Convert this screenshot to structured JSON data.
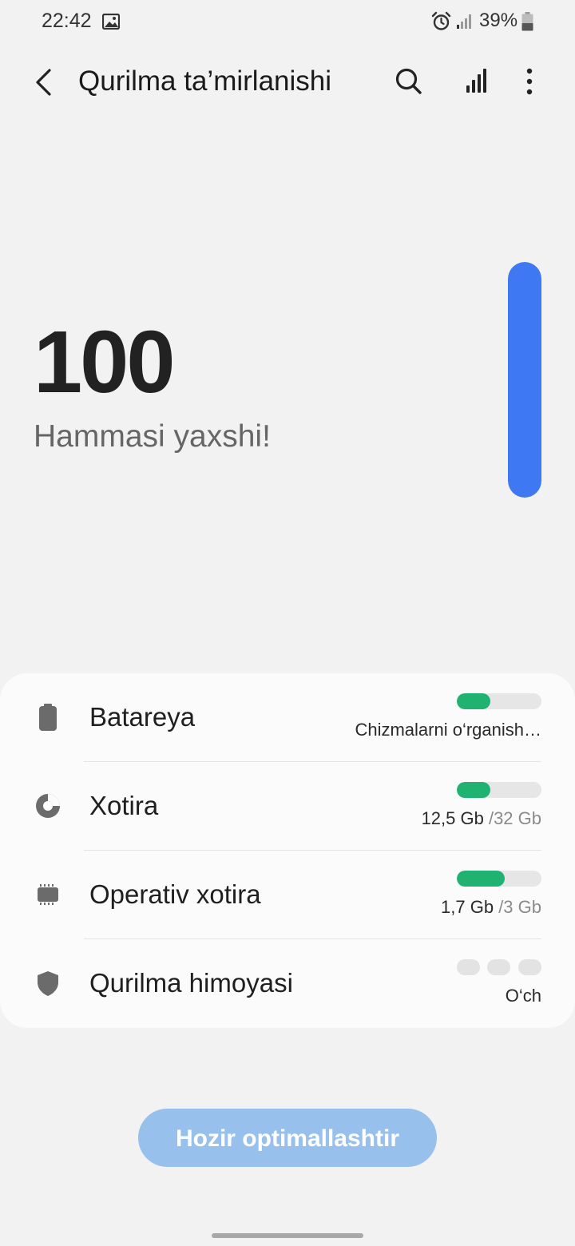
{
  "status_bar": {
    "time": "22:42",
    "battery_percent": "39%",
    "icons": [
      "image-icon",
      "alarm-icon",
      "signal-icon",
      "battery-icon"
    ]
  },
  "header": {
    "title": "Qurilma ta’mirlanishi",
    "icons": [
      "back-icon",
      "search-icon",
      "stats-icon",
      "more-icon"
    ]
  },
  "score": {
    "value": "100",
    "caption": "Hammasi yaxshi!",
    "level": 1.0,
    "bar_color": "#3e78f3"
  },
  "items": [
    {
      "label": "Batareya",
      "icon": "battery-icon",
      "value": "Chizmalarni o‘rganish…",
      "used": "",
      "total": "",
      "level": 0.4
    },
    {
      "label": "Xotira",
      "icon": "storage-pie-icon",
      "value": "",
      "used": "12,5 Gb ",
      "total": "/32 Gb",
      "level": 0.4
    },
    {
      "label": "Operativ xotira",
      "icon": "memory-chip-icon",
      "value": "",
      "used": "1,7 Gb ",
      "total": "/3 Gb",
      "level": 0.57
    },
    {
      "label": "Qurilma himoyasi",
      "icon": "shield-icon",
      "value": "O‘ch",
      "used": "",
      "total": "",
      "level": null
    }
  ],
  "colors": {
    "good": "#1fb271",
    "track": "#e6e6e6",
    "button": "#98c0ec"
  },
  "optimize_button": {
    "label": "Hozir optimallashtir"
  }
}
